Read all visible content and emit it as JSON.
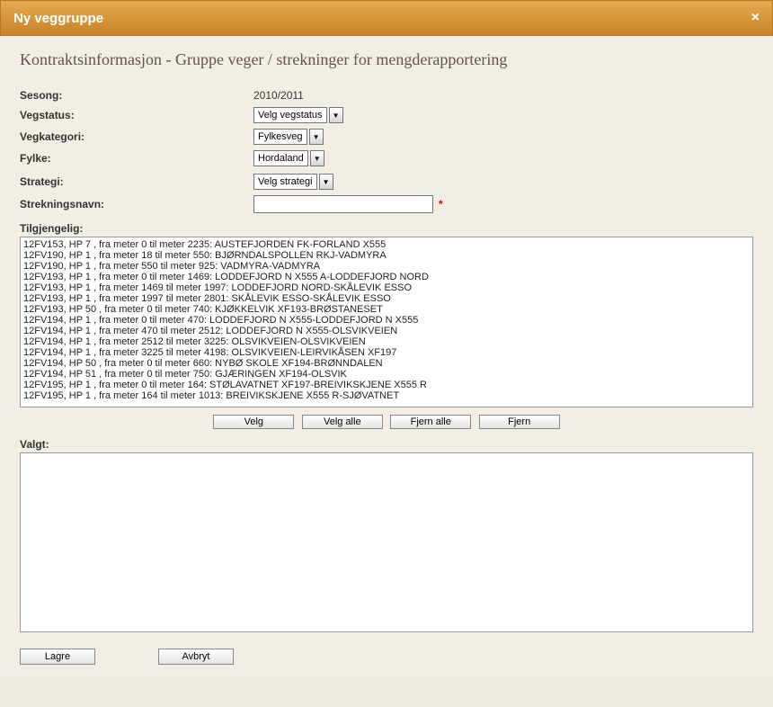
{
  "dialog": {
    "title": "Ny veggruppe",
    "close": "×"
  },
  "page": {
    "title": "Kontraktsinformasjon - Gruppe veger / strekninger for mengderapportering"
  },
  "form": {
    "sesong_label": "Sesong:",
    "sesong_value": "2010/2011",
    "vegstatus_label": "Vegstatus:",
    "vegstatus_value": "Velg vegstatus",
    "vegkategori_label": "Vegkategori:",
    "vegkategori_value": "Fylkesveg",
    "fylke_label": "Fylke:",
    "fylke_value": "Hordaland",
    "strategi_label": "Strategi:",
    "strategi_value": "Velg strategi",
    "strekningsnavn_label": "Strekningsnavn:",
    "strekningsnavn_value": "",
    "required_marker": "*"
  },
  "available": {
    "label": "Tilgjengelig:",
    "items": [
      "12FV153, HP 7 , fra meter 0 til meter 2235: AUSTEFJORDEN FK-FORLAND X555",
      "12FV190, HP 1 , fra meter 18 til meter 550: BJØRNDALSPOLLEN RKJ-VADMYRA",
      "12FV190, HP 1 , fra meter 550 til meter 925: VADMYRA-VADMYRA",
      "12FV193, HP 1 , fra meter 0 til meter 1469: LODDEFJORD N X555 A-LODDEFJORD NORD",
      "12FV193, HP 1 , fra meter 1469 til meter 1997: LODDEFJORD NORD-SKÅLEVIK ESSO",
      "12FV193, HP 1 , fra meter 1997 til meter 2801: SKÅLEVIK ESSO-SKÅLEVIK ESSO",
      "12FV193, HP 50 , fra meter 0 til meter 740: KJØKKELVIK XF193-BRØSTANESET",
      "12FV194, HP 1 , fra meter 0 til meter 470: LODDEFJORD N X555-LODDEFJORD N X555",
      "12FV194, HP 1 , fra meter 470 til meter 2512: LODDEFJORD N X555-OLSVIKVEIEN",
      "12FV194, HP 1 , fra meter 2512 til meter 3225: OLSVIKVEIEN-OLSVIKVEIEN",
      "12FV194, HP 1 , fra meter 3225 til meter 4198: OLSVIKVEIEN-LEIRVIKÅSEN XF197",
      "12FV194, HP 50 , fra meter 0 til meter 660: NYBØ SKOLE XF194-BRØNNDALEN",
      "12FV194, HP 51 , fra meter 0 til meter 750: GJÆRINGEN XF194-OLSVIK",
      "12FV195, HP 1 , fra meter 0 til meter 164: STØLAVATNET XF197-BREIVIKSKJENE X555 R",
      "12FV195, HP 1 , fra meter 164 til meter 1013: BREIVIKSKJENE X555 R-SJØVATNET"
    ]
  },
  "buttons": {
    "velg": "Velg",
    "velg_alle": "Velg alle",
    "fjern_alle": "Fjern alle",
    "fjern": "Fjern"
  },
  "selected": {
    "label": "Valgt:"
  },
  "footer": {
    "lagre": "Lagre",
    "avbryt": "Avbryt"
  }
}
